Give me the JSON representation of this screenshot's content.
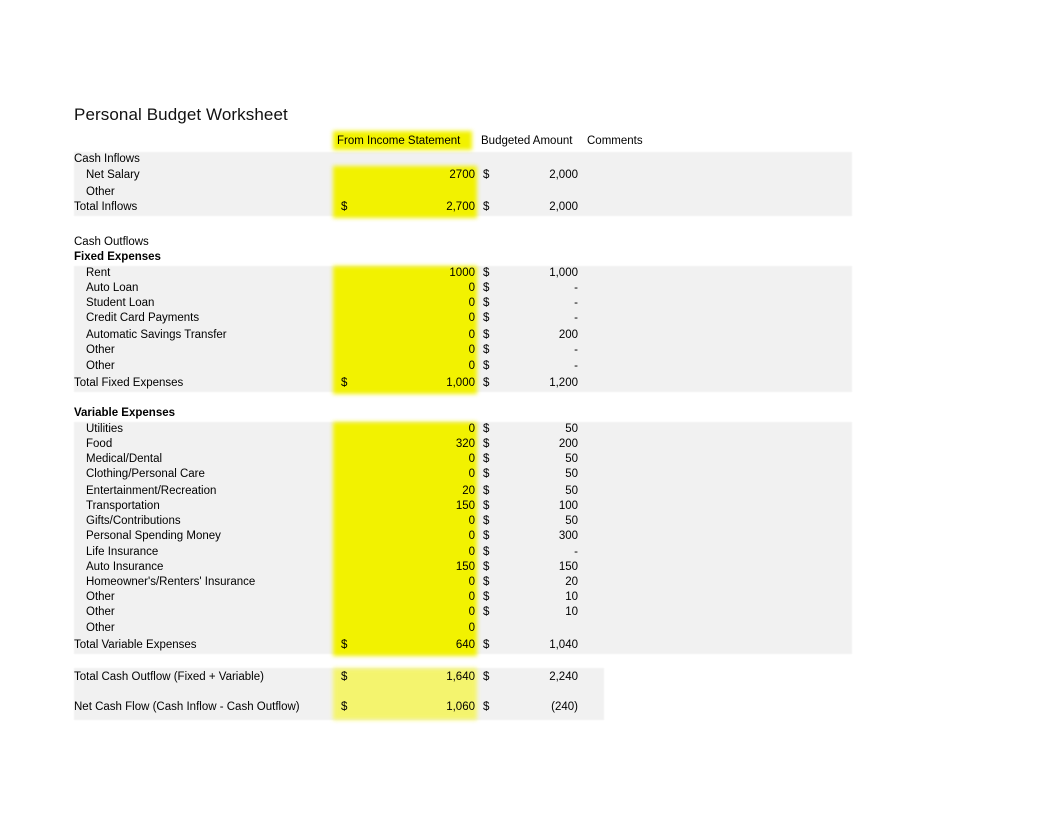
{
  "title": "Personal Budget Worksheet",
  "columns": {
    "income_statement": "From Income Statement",
    "budgeted_amount": "Budgeted Amount",
    "comments": "Comments"
  },
  "currency_symbol": "$",
  "colors": {
    "highlight": "#f2f200",
    "band": "#f1f1f1",
    "text": "#000000"
  },
  "sections": {
    "cash_inflows": {
      "heading": "Cash Inflows",
      "rows": [
        {
          "label": "Net Salary",
          "actual": "2700",
          "actual_currency": "",
          "budget": "2,000",
          "budget_currency": "$",
          "comment": ""
        },
        {
          "label": "Other",
          "actual": "",
          "actual_currency": "",
          "budget": "",
          "budget_currency": "",
          "comment": ""
        }
      ],
      "total": {
        "label": "Total Inflows",
        "actual": "2,700",
        "actual_currency": "$",
        "budget": "2,000",
        "budget_currency": "$",
        "comment": ""
      }
    },
    "cash_outflows": {
      "heading": "Cash Outflows"
    },
    "fixed_expenses": {
      "heading": "Fixed Expenses",
      "rows": [
        {
          "label": "Rent",
          "actual": "1000",
          "actual_currency": "",
          "budget": "1,000",
          "budget_currency": "$",
          "comment": ""
        },
        {
          "label": "Auto Loan",
          "actual": "0",
          "actual_currency": "",
          "budget": "-",
          "budget_currency": "$",
          "comment": ""
        },
        {
          "label": "Student Loan",
          "actual": "0",
          "actual_currency": "",
          "budget": "-",
          "budget_currency": "$",
          "comment": ""
        },
        {
          "label": "Credit Card Payments",
          "actual": "0",
          "actual_currency": "",
          "budget": "-",
          "budget_currency": "$",
          "comment": ""
        },
        {
          "label": "Automatic Savings Transfer",
          "actual": "0",
          "actual_currency": "",
          "budget": "200",
          "budget_currency": "$",
          "comment": ""
        },
        {
          "label": "Other",
          "actual": "0",
          "actual_currency": "",
          "budget": "-",
          "budget_currency": "$",
          "comment": ""
        },
        {
          "label": "Other",
          "actual": "0",
          "actual_currency": "",
          "budget": "-",
          "budget_currency": "$",
          "comment": ""
        }
      ],
      "total": {
        "label": "Total Fixed Expenses",
        "actual": "1,000",
        "actual_currency": "$",
        "budget": "1,200",
        "budget_currency": "$",
        "comment": ""
      }
    },
    "variable_expenses": {
      "heading": "Variable Expenses",
      "rows": [
        {
          "label": "Utilities",
          "actual": "0",
          "actual_currency": "",
          "budget": "50",
          "budget_currency": "$",
          "comment": ""
        },
        {
          "label": "Food",
          "actual": "320",
          "actual_currency": "",
          "budget": "200",
          "budget_currency": "$",
          "comment": ""
        },
        {
          "label": "Medical/Dental",
          "actual": "0",
          "actual_currency": "",
          "budget": "50",
          "budget_currency": "$",
          "comment": ""
        },
        {
          "label": "Clothing/Personal Care",
          "actual": "0",
          "actual_currency": "",
          "budget": "50",
          "budget_currency": "$",
          "comment": ""
        },
        {
          "label": "Entertainment/Recreation",
          "actual": "20",
          "actual_currency": "",
          "budget": "50",
          "budget_currency": "$",
          "comment": ""
        },
        {
          "label": "Transportation",
          "actual": "150",
          "actual_currency": "",
          "budget": "100",
          "budget_currency": "$",
          "comment": ""
        },
        {
          "label": "Gifts/Contributions",
          "actual": "0",
          "actual_currency": "",
          "budget": "50",
          "budget_currency": "$",
          "comment": ""
        },
        {
          "label": "Personal Spending Money",
          "actual": "0",
          "actual_currency": "",
          "budget": "300",
          "budget_currency": "$",
          "comment": ""
        },
        {
          "label": "Life Insurance",
          "actual": "0",
          "actual_currency": "",
          "budget": "-",
          "budget_currency": "$",
          "comment": ""
        },
        {
          "label": "Auto Insurance",
          "actual": "150",
          "actual_currency": "",
          "budget": "150",
          "budget_currency": "$",
          "comment": ""
        },
        {
          "label": "Homeowner's/Renters' Insurance",
          "actual": "0",
          "actual_currency": "",
          "budget": "20",
          "budget_currency": "$",
          "comment": ""
        },
        {
          "label": "Other",
          "actual": "0",
          "actual_currency": "",
          "budget": "10",
          "budget_currency": "$",
          "comment": ""
        },
        {
          "label": "Other",
          "actual": "0",
          "actual_currency": "",
          "budget": "10",
          "budget_currency": "$",
          "comment": ""
        },
        {
          "label": "Other",
          "actual": "0",
          "actual_currency": "",
          "budget": "",
          "budget_currency": "",
          "comment": ""
        }
      ],
      "total": {
        "label": "Total Variable Expenses",
        "actual": "640",
        "actual_currency": "$",
        "budget": "1,040",
        "budget_currency": "$",
        "comment": ""
      }
    },
    "summary": {
      "total_outflow": {
        "label": "Total Cash Outflow (Fixed + Variable)",
        "actual": "1,640",
        "actual_currency": "$",
        "budget": "2,240",
        "budget_currency": "$",
        "comment": ""
      },
      "net_cash_flow": {
        "label": "Net Cash Flow (Cash Inflow - Cash Outflow)",
        "actual": "1,060",
        "actual_currency": "$",
        "budget": "(240)",
        "budget_currency": "$",
        "comment": ""
      }
    }
  }
}
